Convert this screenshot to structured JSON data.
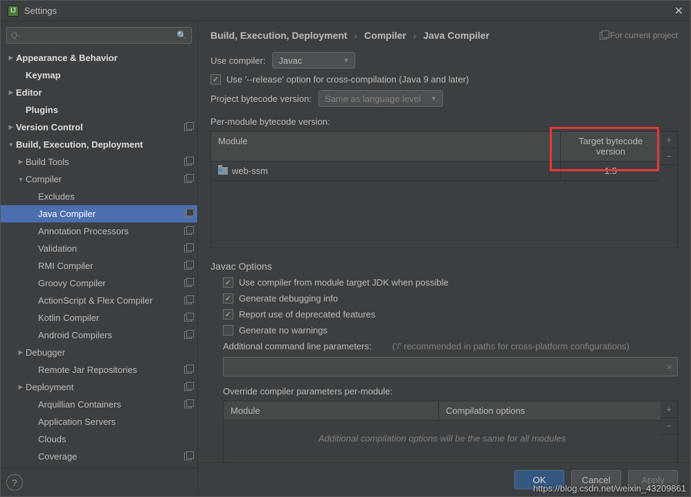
{
  "window": {
    "title": "Settings"
  },
  "search": {
    "placeholder": "Q-"
  },
  "sidebar": {
    "items": [
      {
        "label": "Appearance & Behavior",
        "level": 0,
        "arrow": "▶",
        "bold": true
      },
      {
        "label": "Keymap",
        "level": 1,
        "arrow": "",
        "bold": true
      },
      {
        "label": "Editor",
        "level": 0,
        "arrow": "▶",
        "bold": true
      },
      {
        "label": "Plugins",
        "level": 1,
        "arrow": "",
        "bold": true
      },
      {
        "label": "Version Control",
        "level": 0,
        "arrow": "▶",
        "bold": true,
        "proj": true
      },
      {
        "label": "Build, Execution, Deployment",
        "level": 0,
        "arrow": "▼",
        "bold": true
      },
      {
        "label": "Build Tools",
        "level": 1,
        "arrow": "▶",
        "proj": true
      },
      {
        "label": "Compiler",
        "level": 1,
        "arrow": "▼",
        "proj": true
      },
      {
        "label": "Excludes",
        "level": 2,
        "arrow": ""
      },
      {
        "label": "Java Compiler",
        "level": 2,
        "arrow": "",
        "selected": true,
        "proj": true
      },
      {
        "label": "Annotation Processors",
        "level": 2,
        "arrow": "",
        "proj": true
      },
      {
        "label": "Validation",
        "level": 2,
        "arrow": "",
        "proj": true
      },
      {
        "label": "RMI Compiler",
        "level": 2,
        "arrow": "",
        "proj": true
      },
      {
        "label": "Groovy Compiler",
        "level": 2,
        "arrow": "",
        "proj": true
      },
      {
        "label": "ActionScript & Flex Compiler",
        "level": 2,
        "arrow": "",
        "proj": true
      },
      {
        "label": "Kotlin Compiler",
        "level": 2,
        "arrow": "",
        "proj": true
      },
      {
        "label": "Android Compilers",
        "level": 2,
        "arrow": "",
        "proj": true
      },
      {
        "label": "Debugger",
        "level": 1,
        "arrow": "▶"
      },
      {
        "label": "Remote Jar Repositories",
        "level": 2,
        "arrow": "",
        "proj": true
      },
      {
        "label": "Deployment",
        "level": 1,
        "arrow": "▶",
        "proj": true
      },
      {
        "label": "Arquillian Containers",
        "level": 2,
        "arrow": "",
        "proj": true
      },
      {
        "label": "Application Servers",
        "level": 2,
        "arrow": ""
      },
      {
        "label": "Clouds",
        "level": 2,
        "arrow": ""
      },
      {
        "label": "Coverage",
        "level": 2,
        "arrow": "",
        "proj": true
      }
    ]
  },
  "breadcrumb": {
    "a": "Build, Execution, Deployment",
    "b": "Compiler",
    "c": "Java Compiler"
  },
  "projNote": "For current project",
  "compiler": {
    "useCompilerLabel": "Use compiler:",
    "useCompilerValue": "Javac",
    "releaseOption": "Use '--release' option for cross-compilation (Java 9 and later)",
    "projectBytecodeLabel": "Project bytecode version:",
    "projectBytecodeValue": "Same as language level",
    "perModuleLabel": "Per-module bytecode version:",
    "table1": {
      "colModule": "Module",
      "colTarget": "Target bytecode version",
      "row1": {
        "name": "web-ssm",
        "target": "1.5"
      }
    }
  },
  "javac": {
    "title": "Javac Options",
    "opt1": "Use compiler from module target JDK when possible",
    "opt2": "Generate debugging info",
    "opt3": "Report use of deprecated features",
    "opt4": "Generate no warnings",
    "addlParamsLabel": "Additional command line parameters:",
    "addlParamsHint": "('/' recommended in paths for cross-platform configurations)",
    "overrideLabel": "Override compiler parameters per-module:",
    "table2": {
      "colModule": "Module",
      "colOpts": "Compilation options",
      "emptyMsg": "Additional compilation options will be the same for all modules"
    }
  },
  "buttons": {
    "ok": "OK",
    "cancel": "Cancel",
    "apply": "Apply"
  },
  "watermark": "https://blog.csdn.net/weixin_43209861"
}
